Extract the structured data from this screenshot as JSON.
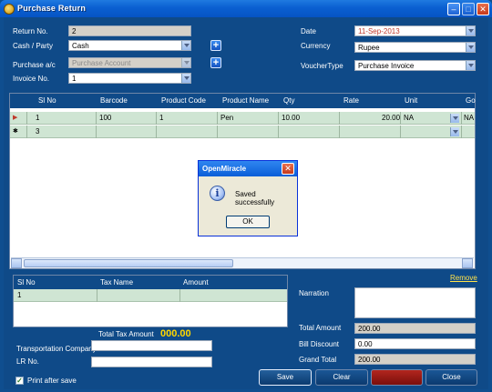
{
  "window": {
    "title": "Purchase Return"
  },
  "form": {
    "return_no_label": "Return No.",
    "return_no": "2",
    "cash_party_label": "Cash / Party",
    "cash_party": "Cash",
    "purchase_ac_label": "Purchase a/c",
    "purchase_ac": "Purchase Account",
    "invoice_no_label": "Invoice No.",
    "invoice_no": "1",
    "date_label": "Date",
    "date": "11-Sep-2013",
    "currency_label": "Currency",
    "currency": "Rupee",
    "voucher_type_label": "VoucherType",
    "voucher_type": "Purchase Invoice"
  },
  "grid": {
    "columns": [
      "Sl No",
      "Barcode",
      "Product Code",
      "Product Name",
      "Qty",
      "Rate",
      "Unit",
      "Go"
    ],
    "rows": [
      {
        "indicator": "▶",
        "sl_no": "1",
        "barcode": "100",
        "product_code": "1",
        "product_name": "Pen",
        "qty": "10.00",
        "rate": "20.00",
        "unit": "NA",
        "godown": "NA"
      },
      {
        "indicator": "✱",
        "sl_no": "3",
        "barcode": "",
        "product_code": "",
        "product_name": "",
        "qty": "",
        "rate": "",
        "unit": "",
        "godown": ""
      }
    ]
  },
  "dialog": {
    "title": "OpenMiracle",
    "message": "Saved successfully",
    "ok_label": "OK"
  },
  "tax_grid": {
    "columns": [
      "Sl No",
      "Tax Name",
      "Amount"
    ],
    "rows": [
      {
        "sl_no": "1",
        "tax_name": "",
        "amount": ""
      }
    ]
  },
  "totals": {
    "total_tax_amount_label": "Total Tax Amount",
    "total_tax_amount": "000.00",
    "transportation_company_label": "Transportation Company",
    "transportation_company": "",
    "lr_no_label": "LR No.",
    "lr_no": "",
    "print_after_save_label": "Print after save",
    "print_after_save": "✓",
    "remove_label": "Remove",
    "narration_label": "Narration",
    "narration": "",
    "total_amount_label": "Total Amount",
    "total_amount": "200.00",
    "bill_discount_label": "Bill Discount",
    "bill_discount": "0.00",
    "grand_total_label": "Grand Total",
    "grand_total": "200.00"
  },
  "buttons": {
    "save": "Save",
    "clear": "Clear",
    "delete": "",
    "close": "Close"
  },
  "colors": {
    "accent": "#0f4a88",
    "row_highlight": "#cfe5d3",
    "total_tax": "#ffd700",
    "delete_button": "#b3261e"
  }
}
